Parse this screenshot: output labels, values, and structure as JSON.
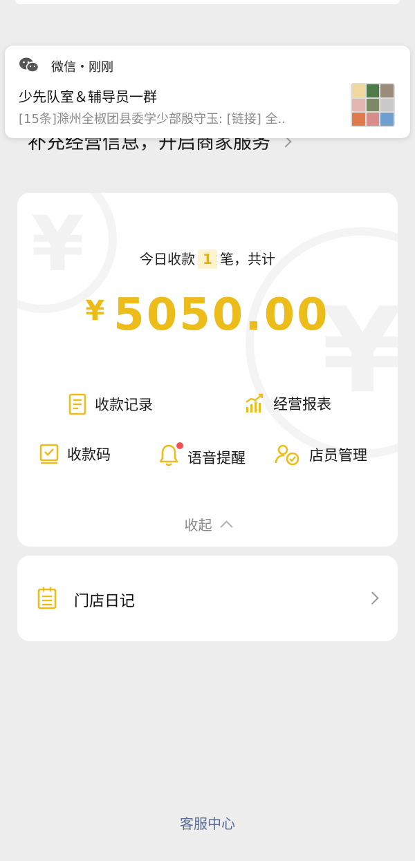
{
  "background_heading": "补充经营信息，开启商家服务",
  "notification": {
    "app_time": "微信・刚刚",
    "title": "少先队室＆辅导员一群",
    "body": "[15条]滁州全椒团县委学少部殷守玉: [链接] 全..",
    "icon": "wechat-icon"
  },
  "summary": {
    "prefix": "今日收款",
    "count": "1",
    "suffix": "笔，共计",
    "currency": "¥",
    "amount": "5050.00"
  },
  "actions": {
    "records": "收款记录",
    "reports": "经营报表",
    "code": "收款码",
    "voice": "语音提醒",
    "staff": "店员管理"
  },
  "collapse_label": "收起",
  "diary_label": "门店日记",
  "service_label": "客服中心",
  "colors": {
    "accent": "#ecbc1a",
    "badge_red": "#f25150",
    "link_blue": "#576b95"
  }
}
